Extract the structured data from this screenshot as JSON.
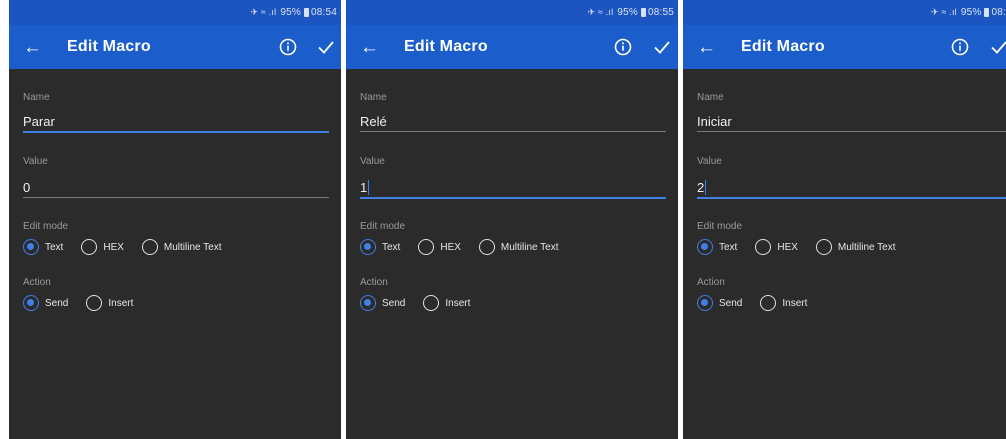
{
  "screens": [
    {
      "status": {
        "signal": "✈︎ ≈ .ıl",
        "battery": "95%",
        "time": "08:54"
      },
      "app_bar": {
        "title": "Edit Macro"
      },
      "name": {
        "label": "Name",
        "value": "Parar",
        "focused": true
      },
      "value": {
        "label": "Value",
        "value": "0",
        "focused": false
      },
      "edit_mode": {
        "label": "Edit mode",
        "options": [
          "Text",
          "HEX",
          "Multiline Text"
        ],
        "selected": "Text"
      },
      "action": {
        "label": "Action",
        "options": [
          "Send",
          "Insert"
        ],
        "selected": "Send"
      }
    },
    {
      "status": {
        "signal": "✈︎ ≈ .ıl",
        "battery": "95%",
        "time": "08:55"
      },
      "app_bar": {
        "title": "Edit Macro"
      },
      "name": {
        "label": "Name",
        "value": "Relé",
        "focused": false
      },
      "value": {
        "label": "Value",
        "value": "1",
        "focused": true
      },
      "edit_mode": {
        "label": "Edit mode",
        "options": [
          "Text",
          "HEX",
          "Multiline Text"
        ],
        "selected": "Text"
      },
      "action": {
        "label": "Action",
        "options": [
          "Send",
          "Insert"
        ],
        "selected": "Send"
      }
    },
    {
      "status": {
        "signal": "✈︎ ≈ .ıl",
        "battery": "95%",
        "time": "08:"
      },
      "app_bar": {
        "title": "Edit Macro"
      },
      "name": {
        "label": "Name",
        "value": "Iniciar",
        "focused": false
      },
      "value": {
        "label": "Value",
        "value": "2",
        "focused": true
      },
      "edit_mode": {
        "label": "Edit mode",
        "options": [
          "Text",
          "HEX",
          "Multiline Text"
        ],
        "selected": "Text"
      },
      "action": {
        "label": "Action",
        "options": [
          "Send",
          "Insert"
        ],
        "selected": "Send"
      }
    }
  ],
  "colors": {
    "app_bar": "#1c5dcc",
    "status_bar": "#1c55c0",
    "background": "#2b2b2b",
    "accent": "#3f7fe6"
  },
  "icons": [
    "back-arrow-icon",
    "info-icon",
    "check-icon",
    "radio-checked-icon",
    "radio-unchecked-icon"
  ]
}
